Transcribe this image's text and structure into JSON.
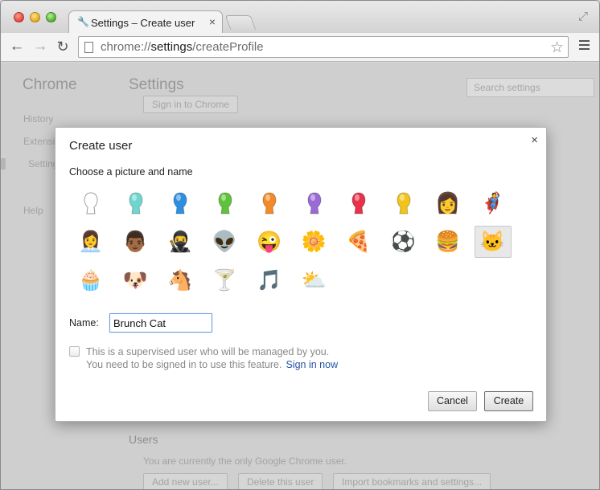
{
  "window": {
    "tab_title": "Settings – Create user",
    "tab_close": "×",
    "url_scheme": "chrome://",
    "url_host": "settings",
    "url_path": "/createProfile"
  },
  "background_page": {
    "app_title": "Chrome",
    "section_title": "Settings",
    "search_placeholder": "Search settings",
    "nav": [
      "History",
      "Extensions",
      "Settings",
      "Help"
    ],
    "sign_in_button": "Sign in to Chrome",
    "users_heading": "Users",
    "users_text": "You are currently the only Google Chrome user.",
    "buttons": [
      "Add new user...",
      "Delete this user",
      "Import bookmarks and settings..."
    ]
  },
  "dialog": {
    "title": "Create user",
    "close": "×",
    "subtitle": "Choose a picture and name",
    "avatars": [
      {
        "name": "white-head",
        "glyph": "head",
        "color": "#ffffff"
      },
      {
        "name": "teal-head",
        "glyph": "head",
        "color": "#6fd6cf"
      },
      {
        "name": "blue-head",
        "glyph": "head",
        "color": "#2e8fe0"
      },
      {
        "name": "green-head",
        "glyph": "head",
        "color": "#5fc23a"
      },
      {
        "name": "orange-head",
        "glyph": "head",
        "color": "#f28a2a"
      },
      {
        "name": "purple-head",
        "glyph": "head",
        "color": "#9a6ad6"
      },
      {
        "name": "red-head",
        "glyph": "head",
        "color": "#e8324a"
      },
      {
        "name": "yellow-head",
        "glyph": "head",
        "color": "#f2c419"
      },
      {
        "name": "blonde-woman",
        "glyph": "👩"
      },
      {
        "name": "superhero",
        "glyph": "🦸"
      },
      {
        "name": "businesswoman",
        "glyph": "👩‍💼"
      },
      {
        "name": "man",
        "glyph": "👨🏾"
      },
      {
        "name": "ninja",
        "glyph": "🥷"
      },
      {
        "name": "alien",
        "glyph": "👽"
      },
      {
        "name": "smiley",
        "glyph": "😜"
      },
      {
        "name": "flower",
        "glyph": "🌼"
      },
      {
        "name": "pizza",
        "glyph": "🍕"
      },
      {
        "name": "soccer-ball",
        "glyph": "⚽"
      },
      {
        "name": "burger",
        "glyph": "🍔"
      },
      {
        "name": "cat",
        "glyph": "🐱",
        "selected": true
      },
      {
        "name": "cupcake",
        "glyph": "🧁"
      },
      {
        "name": "dog",
        "glyph": "🐶"
      },
      {
        "name": "horse",
        "glyph": "🐴"
      },
      {
        "name": "cocktail",
        "glyph": "🍸"
      },
      {
        "name": "music-note",
        "glyph": "🎵"
      },
      {
        "name": "sun-cloud",
        "glyph": "⛅"
      }
    ],
    "name_label": "Name:",
    "name_value": "Brunch Cat",
    "supervised_text": "This is a supervised user who will be managed by you.",
    "signin_note": "You need to be signed in to use this feature.",
    "signin_link": "Sign in now",
    "cancel_label": "Cancel",
    "create_label": "Create"
  }
}
